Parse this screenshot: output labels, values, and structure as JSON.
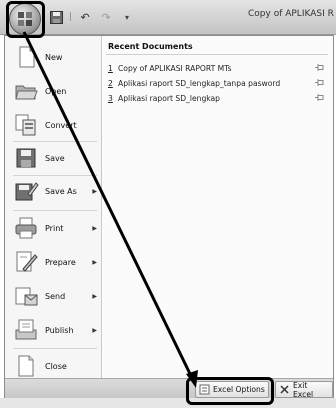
{
  "window": {
    "title": "Copy of APLIKASI R"
  },
  "quick_access": {
    "separator": "|",
    "undo_label": "↶",
    "redo_label": "↷",
    "dropdown_label": "▾"
  },
  "menu": {
    "commands": [
      {
        "id": "new",
        "label": "New",
        "icon": "new-document-icon",
        "has_arrow": false
      },
      {
        "id": "open",
        "label": "Open",
        "icon": "folder-open-icon",
        "has_arrow": false
      },
      {
        "id": "convert",
        "label": "Convert",
        "icon": "convert-icon",
        "has_arrow": false
      },
      {
        "id": "save",
        "label": "Save",
        "icon": "floppy-disk-icon",
        "has_arrow": false
      },
      {
        "id": "save-as",
        "label": "Save As",
        "icon": "save-as-icon",
        "has_arrow": true
      },
      {
        "id": "print",
        "label": "Print",
        "icon": "printer-icon",
        "has_arrow": true
      },
      {
        "id": "prepare",
        "label": "Prepare",
        "icon": "prepare-icon",
        "has_arrow": true
      },
      {
        "id": "send",
        "label": "Send",
        "icon": "send-icon",
        "has_arrow": true
      },
      {
        "id": "publish",
        "label": "Publish",
        "icon": "publish-icon",
        "has_arrow": true
      },
      {
        "id": "close",
        "label": "Close",
        "icon": "close-document-icon",
        "has_arrow": false
      }
    ],
    "arrow_glyph": "▶",
    "recent": {
      "title": "Recent Documents",
      "items": [
        {
          "num": "1",
          "name": "Copy of APLIKASI RAPORT MTs"
        },
        {
          "num": "2",
          "name": "Aplikasi raport SD_lengkap_tanpa pasword"
        },
        {
          "num": "3",
          "name": "Aplikasi raport SD_lengkap"
        }
      ]
    },
    "footer": {
      "options_label": "Excel Options",
      "exit_label": "Exit Excel"
    }
  },
  "colors": {
    "highlight": "#000000",
    "menu_bg": "#f1f1f1"
  }
}
